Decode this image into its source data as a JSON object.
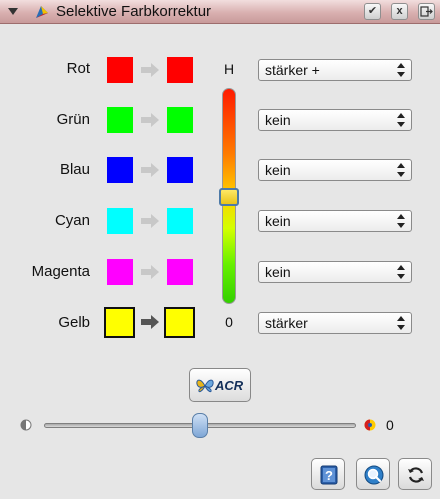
{
  "window": {
    "title": "Selektive Farbkorrektur",
    "buttons": {
      "check": "✔",
      "close": "x"
    }
  },
  "colors": {
    "titlebar_top": "#f2dede",
    "titlebar_bottom": "#c89a9a",
    "panel_bg": "#e6e6e6"
  },
  "hue_scale": {
    "top_label": "H",
    "bottom_label": "0",
    "thumb_level": 0.5
  },
  "rows": [
    {
      "label": "Rot",
      "source_color": "#ff0000",
      "target_color": "#ff0000",
      "selected": "stärker +",
      "active": false
    },
    {
      "label": "Grün",
      "source_color": "#00ff00",
      "target_color": "#00ff00",
      "selected": "kein",
      "active": false
    },
    {
      "label": "Blau",
      "source_color": "#0000ff",
      "target_color": "#0000ff",
      "selected": "kein",
      "active": false
    },
    {
      "label": "Cyan",
      "source_color": "#00ffff",
      "target_color": "#00ffff",
      "selected": "kein",
      "active": false
    },
    {
      "label": "Magenta",
      "source_color": "#ff00ff",
      "target_color": "#ff00ff",
      "selected": "kein",
      "active": false
    },
    {
      "label": "Gelb",
      "source_color": "#ffff00",
      "target_color": "#ffff00",
      "selected": "stärker",
      "active": true
    }
  ],
  "acr_button": {
    "label": "ACR"
  },
  "slider": {
    "value": "0",
    "level": 0.5
  },
  "bottom_buttons": [
    {
      "icon": "help-icon"
    },
    {
      "icon": "preview-icon"
    },
    {
      "icon": "reset-icon"
    }
  ]
}
